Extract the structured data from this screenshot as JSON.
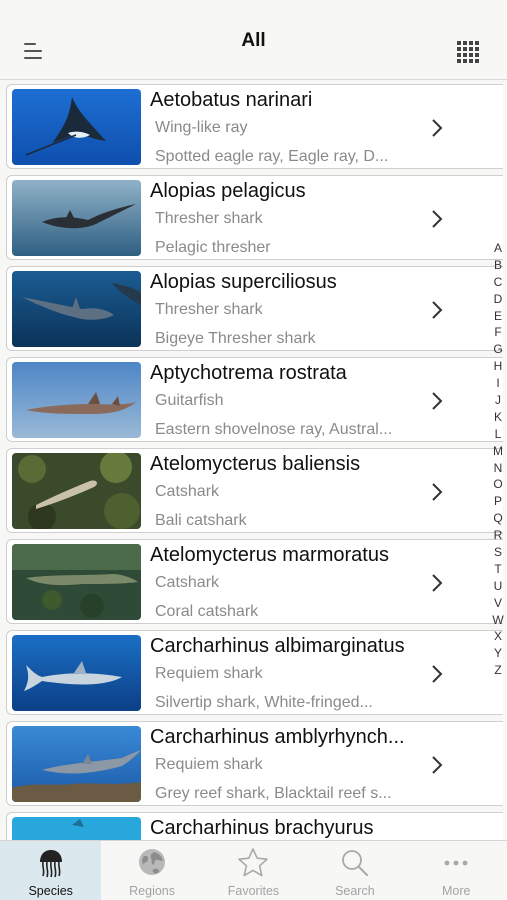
{
  "header": {
    "title": "All",
    "menu_icon": "hamburger-menu-icon",
    "grid_icon": "grid-view-icon"
  },
  "species": [
    {
      "scientific": "Aetobatus narinari",
      "family": "Wing-like ray",
      "common": "Spotted eagle ray, Eagle ray, D...",
      "photo": "eagle-ray-photo"
    },
    {
      "scientific": "Alopias pelagicus",
      "family": "Thresher shark",
      "common": "Pelagic thresher",
      "photo": "pelagic-thresher-photo"
    },
    {
      "scientific": "Alopias superciliosus",
      "family": "Thresher shark",
      "common": "Bigeye Thresher shark",
      "photo": "bigeye-thresher-photo"
    },
    {
      "scientific": "Aptychotrema rostrata",
      "family": "Guitarfish",
      "common": "Eastern shovelnose ray, Austral...",
      "photo": "guitarfish-photo"
    },
    {
      "scientific": "Atelomycterus baliensis",
      "family": "Catshark",
      "common": "Bali catshark",
      "photo": "bali-catshark-photo"
    },
    {
      "scientific": "Atelomycterus marmoratus",
      "family": "Catshark",
      "common": "Coral catshark",
      "photo": "coral-catshark-photo"
    },
    {
      "scientific": "Carcharhinus albimarginatus",
      "family": "Requiem shark",
      "common": "Silvertip shark, White-fringed...",
      "photo": "silvertip-shark-photo"
    },
    {
      "scientific": "Carcharhinus amblyrhynch...",
      "family": "Requiem shark",
      "common": "Grey reef shark, Blacktail reef s...",
      "photo": "grey-reef-shark-photo"
    },
    {
      "scientific": "Carcharhinus brachyurus",
      "family": "",
      "common": "",
      "photo": "bronze-whaler-photo"
    }
  ],
  "alphabet": [
    "A",
    "B",
    "C",
    "D",
    "E",
    "F",
    "G",
    "H",
    "I",
    "J",
    "K",
    "L",
    "M",
    "N",
    "O",
    "P",
    "Q",
    "R",
    "S",
    "T",
    "U",
    "V",
    "W",
    "X",
    "Y",
    "Z"
  ],
  "tabs": [
    {
      "label": "Species",
      "icon": "jellyfish-icon",
      "active": true
    },
    {
      "label": "Regions",
      "icon": "globe-icon",
      "active": false
    },
    {
      "label": "Favorites",
      "icon": "star-icon",
      "active": false
    },
    {
      "label": "Search",
      "icon": "search-icon",
      "active": false
    },
    {
      "label": "More",
      "icon": "more-dots-icon",
      "active": false
    }
  ],
  "colors": {
    "active_tab_bg": "#dbe9ef",
    "inactive_text": "#a3a3a3",
    "secondary_text": "#8a8a8a"
  }
}
